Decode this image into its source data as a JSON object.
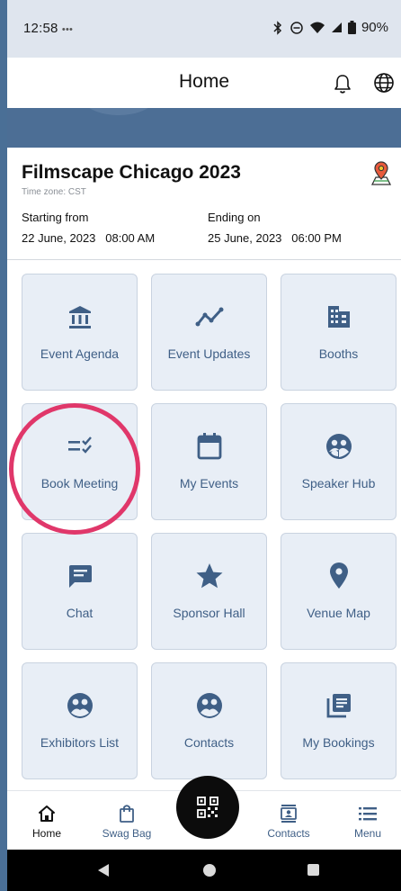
{
  "status_bar": {
    "time": "12:58",
    "notifications": "•••",
    "battery": "90%",
    "icons": [
      "bluetooth-icon",
      "dnd-icon",
      "wifi-icon",
      "signal-icon",
      "battery-icon"
    ]
  },
  "header": {
    "title": "Home",
    "icons": [
      "bell-icon",
      "globe-icon"
    ]
  },
  "event": {
    "title": "Filmscape Chicago 2023",
    "timezone": "Time zone: CST",
    "start_label": "Starting from",
    "start_value": "22 June, 2023   08:00 AM",
    "end_label": "Ending on",
    "end_value": "25 June, 2023   06:00 PM",
    "icon": "map-location-icon"
  },
  "tiles": [
    {
      "label": "Event Agenda",
      "icon": "bank-icon"
    },
    {
      "label": "Event Updates",
      "icon": "trend-line-icon"
    },
    {
      "label": "Booths",
      "icon": "building-icon"
    },
    {
      "label": "Book Meeting",
      "icon": "checklist-icon"
    },
    {
      "label": "My Events",
      "icon": "calendar-icon"
    },
    {
      "label": "Speaker Hub",
      "icon": "speaker-group-icon"
    },
    {
      "label": "Chat",
      "icon": "chat-icon"
    },
    {
      "label": "Sponsor Hall",
      "icon": "star-icon"
    },
    {
      "label": "Venue Map",
      "icon": "location-pin-icon"
    },
    {
      "label": "Exhibitors List",
      "icon": "exhibitors-icon"
    },
    {
      "label": "Contacts",
      "icon": "contacts-group-icon"
    },
    {
      "label": "My Bookings",
      "icon": "bookings-icon"
    }
  ],
  "highlighted_tile": "Book Meeting",
  "bottom_nav": {
    "items": [
      {
        "label": "Home",
        "icon": "home-icon",
        "active": true
      },
      {
        "label": "Swag Bag",
        "icon": "bag-icon",
        "active": false
      },
      {
        "label": "Contacts",
        "icon": "contact-card-icon",
        "active": false
      },
      {
        "label": "Menu",
        "icon": "menu-icon",
        "active": false
      }
    ],
    "fab_icon": "qr-code-icon"
  },
  "colors": {
    "accent": "#3f5f86",
    "tile_bg": "#e8eef6",
    "highlight": "#e0376a",
    "banner": "#4c6e95"
  }
}
